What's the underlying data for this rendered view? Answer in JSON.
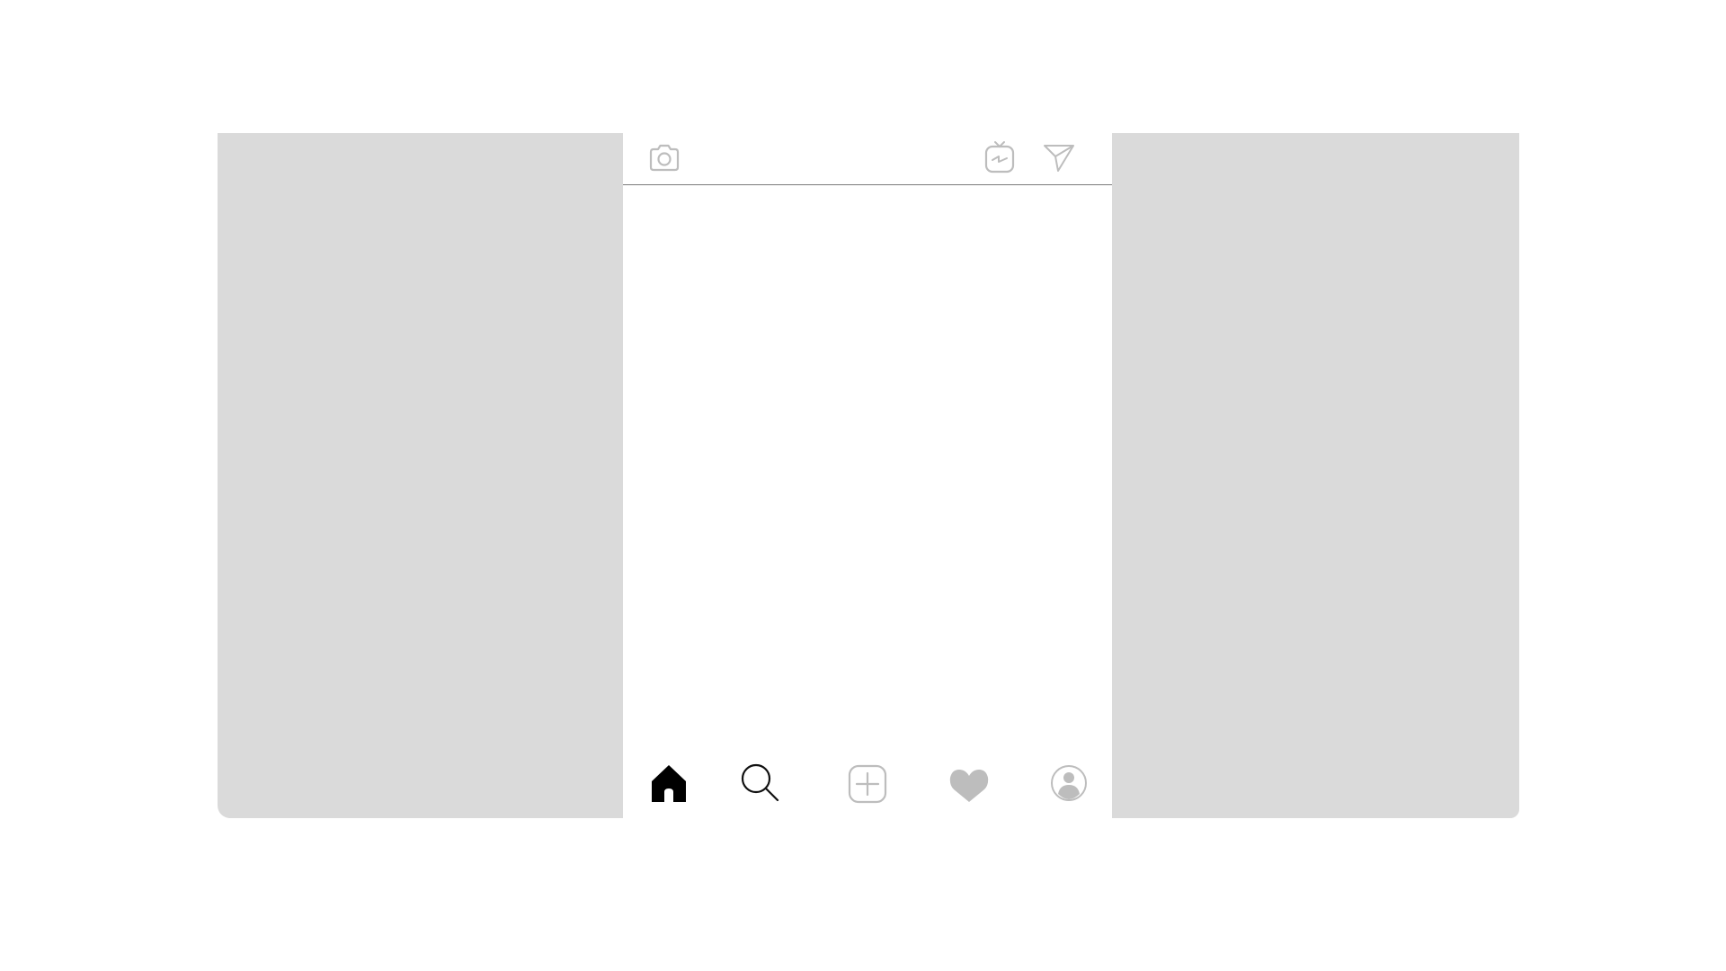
{
  "app": {
    "top_bar": {
      "left_icon": "camera-icon",
      "right_icons": [
        "igtv-icon",
        "direct-message-icon"
      ]
    },
    "bottom_nav": {
      "items": [
        {
          "icon": "home-icon",
          "active": true
        },
        {
          "icon": "search-icon",
          "active": false
        },
        {
          "icon": "add-post-icon",
          "active": false
        },
        {
          "icon": "heart-icon",
          "active": false
        },
        {
          "icon": "profile-icon",
          "active": false
        }
      ]
    },
    "colors": {
      "side_panel": "#dadada",
      "icon_inactive": "#bdbdbd",
      "icon_active": "#000000",
      "divider": "#7a7a7a",
      "background": "#ffffff"
    }
  }
}
